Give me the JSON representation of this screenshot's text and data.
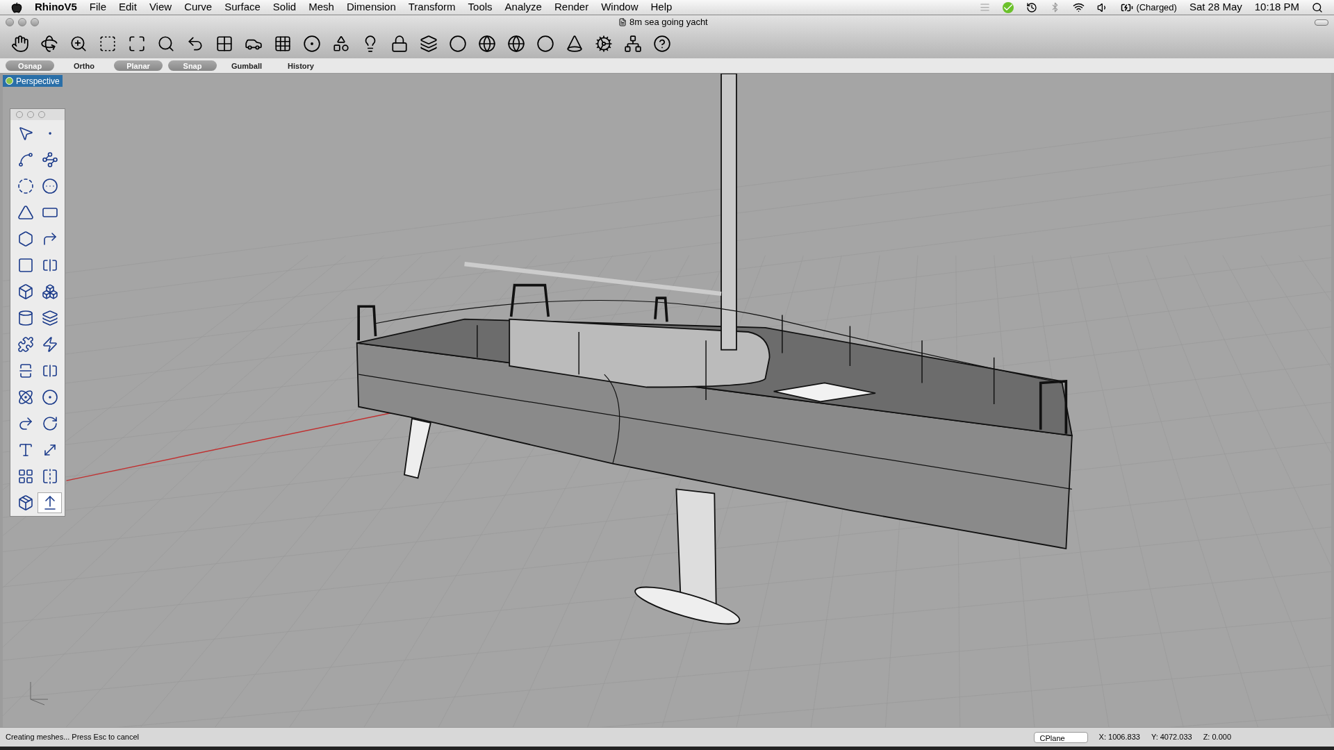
{
  "menu_bar": {
    "app": "RhinoV5",
    "menus": [
      "File",
      "Edit",
      "View",
      "Curve",
      "Surface",
      "Solid",
      "Mesh",
      "Dimension",
      "Transform",
      "Tools",
      "Analyze",
      "Render",
      "Window",
      "Help"
    ],
    "battery": "(Charged)",
    "date": "Sat 28 May",
    "time": "10:18 PM"
  },
  "window": {
    "title": "8m sea going yacht"
  },
  "modes": [
    {
      "label": "Osnap",
      "on": true
    },
    {
      "label": "Ortho",
      "on": false
    },
    {
      "label": "Planar",
      "on": true
    },
    {
      "label": "Snap",
      "on": true
    },
    {
      "label": "Gumball",
      "on": false
    },
    {
      "label": "History",
      "on": false
    }
  ],
  "viewport": {
    "title": "Perspective"
  },
  "tool_palette": {
    "buttons": [
      {
        "selected": false
      },
      {
        "selected": false
      },
      {
        "selected": false
      },
      {
        "selected": false
      },
      {
        "selected": false
      },
      {
        "selected": false
      },
      {
        "selected": false
      },
      {
        "selected": false
      },
      {
        "selected": false
      },
      {
        "selected": false
      },
      {
        "selected": false
      },
      {
        "selected": false
      },
      {
        "selected": false
      },
      {
        "selected": false
      },
      {
        "selected": false
      },
      {
        "selected": false
      },
      {
        "selected": false
      },
      {
        "selected": false
      },
      {
        "selected": false
      },
      {
        "selected": false
      },
      {
        "selected": false
      },
      {
        "selected": false
      },
      {
        "selected": false
      },
      {
        "selected": false
      },
      {
        "selected": false
      },
      {
        "selected": false
      },
      {
        "selected": false
      },
      {
        "selected": false
      },
      {
        "selected": false
      },
      {
        "selected": true
      }
    ]
  },
  "status_bar": {
    "message": "Creating meshes... Press Esc to cancel",
    "cplane": "CPlane",
    "x": "X: 1006.833",
    "y": "Y: 4072.033",
    "z": "Z: 0.000"
  }
}
